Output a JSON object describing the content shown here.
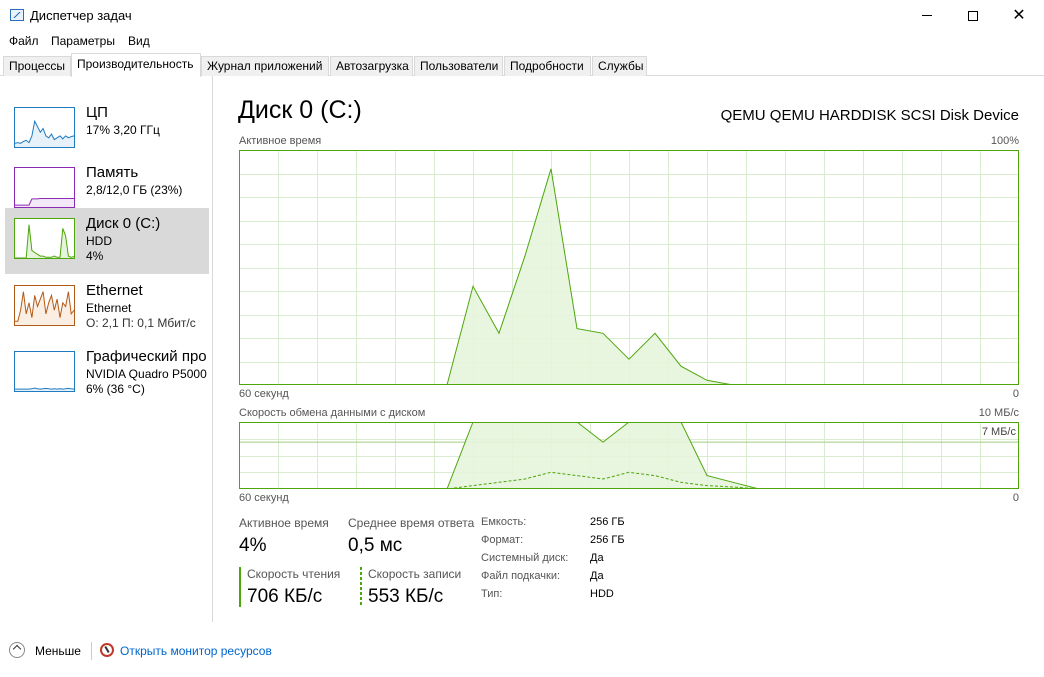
{
  "window": {
    "title": "Диспетчер задач"
  },
  "menu": [
    "Файл",
    "Параметры",
    "Вид"
  ],
  "tabs": [
    {
      "label": "Процессы",
      "active": false
    },
    {
      "label": "Производительность",
      "active": true
    },
    {
      "label": "Журнал приложений",
      "active": false
    },
    {
      "label": "Автозагрузка",
      "active": false
    },
    {
      "label": "Пользователи",
      "active": false
    },
    {
      "label": "Подробности",
      "active": false
    },
    {
      "label": "Службы",
      "active": false
    }
  ],
  "resources": [
    {
      "name": "ЦП",
      "line1": "17% 3,20 ГГц",
      "line2": "",
      "color": "#1f7bbf",
      "fill": "#e7f1f9",
      "series": [
        0.1,
        0.12,
        0.1,
        0.15,
        0.18,
        0.12,
        0.3,
        0.7,
        0.55,
        0.4,
        0.5,
        0.3,
        0.25,
        0.35,
        0.2,
        0.25,
        0.3,
        0.22,
        0.3,
        0.25,
        0.28,
        0.3
      ]
    },
    {
      "name": "Память",
      "line1": "2,8/12,0 ГБ (23%)",
      "line2": "",
      "color": "#8b2ab3",
      "fill": "#f3e8f8",
      "series": [
        0.05,
        0.05,
        0.05,
        0.05,
        0.05,
        0.05,
        0.22,
        0.22,
        0.22,
        0.23,
        0.23,
        0.23,
        0.23,
        0.23,
        0.23,
        0.23,
        0.23,
        0.23,
        0.23,
        0.23,
        0.23,
        0.23
      ]
    },
    {
      "name": "Диск 0 (C:)",
      "line1": "HDD",
      "line2": "4%",
      "color": "#4da60c",
      "fill": "#e6f4dc",
      "series": [
        0,
        0,
        0,
        0,
        0,
        0.9,
        0.2,
        0.15,
        0.1,
        0.05,
        0.05,
        0.02,
        0.02,
        0.02,
        0.05,
        0.02,
        0.02,
        0.8,
        0.6,
        0.05,
        0.02,
        0.04
      ]
    },
    {
      "name": "Ethernet",
      "line1": "Ethernet",
      "line2": "О: 2,1 П: 0,1 Мбит/с",
      "color": "#b25a17",
      "fill": "#fbeee3",
      "series": [
        0.1,
        0.1,
        0.4,
        0.9,
        0.3,
        0.6,
        0.2,
        0.8,
        0.5,
        0.7,
        0.9,
        0.3,
        0.6,
        0.8,
        0.4,
        0.7,
        0.2,
        0.6,
        0.5,
        0.9,
        0.3,
        0.4
      ]
    },
    {
      "name": "Графический про",
      "line1": "NVIDIA Quadro P5000",
      "line2": "6% (36 °C)",
      "color": "#1f7bbf",
      "fill": "#e7f1f9",
      "series": [
        0.05,
        0.05,
        0.05,
        0.05,
        0.05,
        0.05,
        0.06,
        0.08,
        0.06,
        0.05,
        0.06,
        0.07,
        0.06,
        0.05,
        0.06,
        0.05,
        0.06,
        0.05,
        0.06,
        0.07,
        0.06,
        0.05
      ]
    }
  ],
  "main": {
    "title": "Диск 0 (C:)",
    "device": "QEMU QEMU HARDDISK SCSI Disk Device",
    "active_chart": {
      "label": "Активное время",
      "max_label": "100%",
      "x_left": "60 секунд",
      "x_right": "0"
    },
    "transfer_chart": {
      "label": "Скорость обмена данными с диском",
      "max_label": "10 МБ/с",
      "line_label": "7 МБ/с",
      "x_left": "60 секунд",
      "x_right": "0"
    },
    "stats": {
      "active_time_label": "Активное время",
      "active_time": "4%",
      "response_label": "Среднее время ответа",
      "response": "0,5 мс",
      "read_label": "Скорость чтения",
      "read": "706 КБ/с",
      "write_label": "Скорость записи",
      "write": "553 КБ/с"
    },
    "info": [
      {
        "label": "Емкость:",
        "value": "256 ГБ"
      },
      {
        "label": "Формат:",
        "value": "256 ГБ"
      },
      {
        "label": "Системный диск:",
        "value": "Да"
      },
      {
        "label": "Файл подкачки:",
        "value": "Да"
      },
      {
        "label": "Тип:",
        "value": "HDD"
      }
    ]
  },
  "footer": {
    "less": "Меньше",
    "monitor": "Открыть монитор ресурсов"
  },
  "chart_data": [
    {
      "type": "area",
      "title": "Активное время",
      "ylabel": "",
      "ylim": [
        0,
        100
      ],
      "x": [
        60,
        58,
        56,
        54,
        52,
        50,
        48,
        46,
        44,
        42,
        40,
        38,
        36,
        34,
        32,
        30,
        28,
        26,
        24,
        22,
        20,
        18,
        16,
        14,
        12,
        10,
        8,
        6,
        4,
        2,
        0
      ],
      "series": [
        {
          "values": [
            0,
            0,
            0,
            0,
            0,
            0,
            0,
            0,
            0,
            42,
            22,
            55,
            92,
            24,
            22,
            11,
            22,
            8,
            2,
            0,
            0,
            0,
            0,
            0,
            0,
            0,
            0,
            0,
            0,
            0,
            0
          ]
        }
      ]
    },
    {
      "type": "area",
      "title": "Скорость обмена данными с диском",
      "ylabel": "",
      "ylim": [
        0,
        10
      ],
      "series": [
        {
          "values": [
            0,
            0,
            0,
            0,
            0,
            0,
            0,
            0,
            0,
            10,
            10,
            10,
            10,
            10,
            7,
            10,
            10,
            10,
            2,
            1,
            0,
            0,
            0,
            0,
            0,
            0,
            0,
            0,
            0,
            0,
            0
          ]
        },
        {
          "values": [
            0,
            0,
            0,
            0,
            0,
            0,
            0,
            0,
            0,
            0.5,
            1,
            1.5,
            2.5,
            2,
            1.5,
            2.5,
            2,
            1,
            0.5,
            0.3,
            0,
            0,
            0,
            0,
            0,
            0,
            0,
            0,
            0,
            0,
            0
          ]
        }
      ]
    }
  ]
}
